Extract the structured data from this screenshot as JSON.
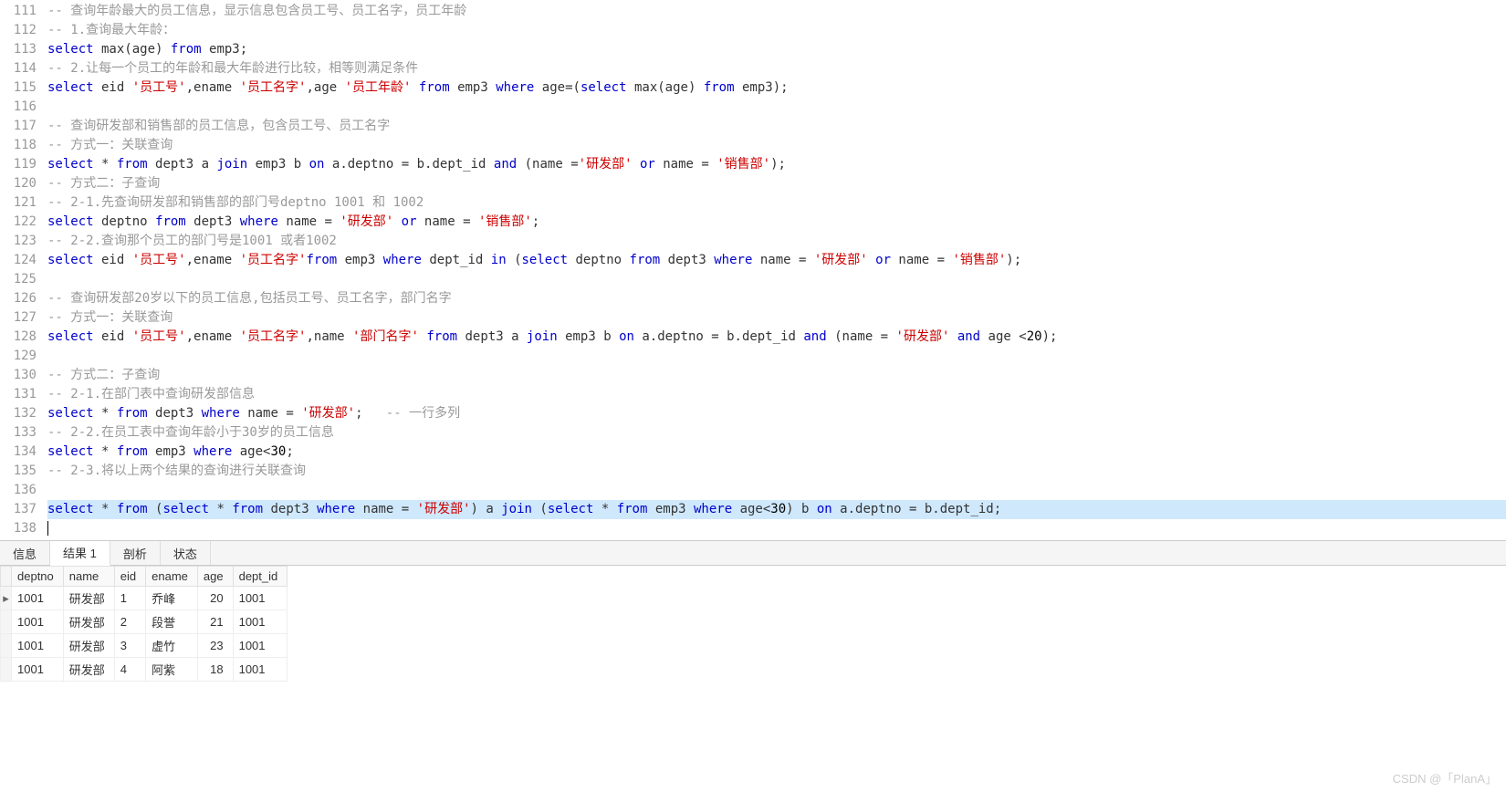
{
  "lines": [
    {
      "n": 111,
      "tokens": [
        {
          "t": "-- 查询年龄最大的员工信息，显示信息包含员工号、员工名字，员工年龄",
          "c": "cmt"
        }
      ]
    },
    {
      "n": 112,
      "tokens": [
        {
          "t": "-- 1.查询最大年龄：",
          "c": "cmt"
        }
      ]
    },
    {
      "n": 113,
      "tokens": [
        {
          "t": "select",
          "c": "kw"
        },
        {
          "t": " max(age) ",
          "c": "ident"
        },
        {
          "t": "from",
          "c": "kw"
        },
        {
          "t": " emp3;",
          "c": "ident"
        }
      ]
    },
    {
      "n": 114,
      "tokens": [
        {
          "t": "-- 2.让每一个员工的年龄和最大年龄进行比较，相等则满足条件",
          "c": "cmt"
        }
      ]
    },
    {
      "n": 115,
      "tokens": [
        {
          "t": "select",
          "c": "kw"
        },
        {
          "t": " eid ",
          "c": "ident"
        },
        {
          "t": "'员工号'",
          "c": "str"
        },
        {
          "t": ",ename ",
          "c": "ident"
        },
        {
          "t": "'员工名字'",
          "c": "str"
        },
        {
          "t": ",age ",
          "c": "ident"
        },
        {
          "t": "'员工年龄'",
          "c": "str"
        },
        {
          "t": " ",
          "c": "ident"
        },
        {
          "t": "from",
          "c": "kw"
        },
        {
          "t": " emp3 ",
          "c": "ident"
        },
        {
          "t": "where",
          "c": "kw"
        },
        {
          "t": " age=(",
          "c": "ident"
        },
        {
          "t": "select",
          "c": "kw"
        },
        {
          "t": " max(age) ",
          "c": "ident"
        },
        {
          "t": "from",
          "c": "kw"
        },
        {
          "t": " emp3);",
          "c": "ident"
        }
      ]
    },
    {
      "n": 116,
      "tokens": []
    },
    {
      "n": 117,
      "tokens": [
        {
          "t": "-- 查询研发部和销售部的员工信息，包含员工号、员工名字",
          "c": "cmt"
        }
      ]
    },
    {
      "n": 118,
      "tokens": [
        {
          "t": "-- 方式一：关联查询",
          "c": "cmt"
        }
      ]
    },
    {
      "n": 119,
      "tokens": [
        {
          "t": "select",
          "c": "kw"
        },
        {
          "t": " * ",
          "c": "ident"
        },
        {
          "t": "from",
          "c": "kw"
        },
        {
          "t": " dept3 a ",
          "c": "ident"
        },
        {
          "t": "join",
          "c": "kw"
        },
        {
          "t": " emp3 b ",
          "c": "ident"
        },
        {
          "t": "on",
          "c": "kw"
        },
        {
          "t": " a.deptno = b.dept_id ",
          "c": "ident"
        },
        {
          "t": "and",
          "c": "kw"
        },
        {
          "t": " (name =",
          "c": "ident"
        },
        {
          "t": "'研发部'",
          "c": "str"
        },
        {
          "t": " ",
          "c": "ident"
        },
        {
          "t": "or",
          "c": "kw"
        },
        {
          "t": " name = ",
          "c": "ident"
        },
        {
          "t": "'销售部'",
          "c": "str"
        },
        {
          "t": ");",
          "c": "ident"
        }
      ]
    },
    {
      "n": 120,
      "tokens": [
        {
          "t": "-- 方式二：子查询",
          "c": "cmt"
        }
      ]
    },
    {
      "n": 121,
      "tokens": [
        {
          "t": "-- 2-1.先查询研发部和销售部的部门号deptno 1001 和 1002",
          "c": "cmt"
        }
      ]
    },
    {
      "n": 122,
      "tokens": [
        {
          "t": "select",
          "c": "kw"
        },
        {
          "t": " deptno ",
          "c": "ident"
        },
        {
          "t": "from",
          "c": "kw"
        },
        {
          "t": " dept3 ",
          "c": "ident"
        },
        {
          "t": "where",
          "c": "kw"
        },
        {
          "t": " name = ",
          "c": "ident"
        },
        {
          "t": "'研发部'",
          "c": "str"
        },
        {
          "t": " ",
          "c": "ident"
        },
        {
          "t": "or",
          "c": "kw"
        },
        {
          "t": " name = ",
          "c": "ident"
        },
        {
          "t": "'销售部'",
          "c": "str"
        },
        {
          "t": ";",
          "c": "ident"
        }
      ]
    },
    {
      "n": 123,
      "tokens": [
        {
          "t": "-- 2-2.查询那个员工的部门号是1001 或者1002",
          "c": "cmt"
        }
      ]
    },
    {
      "n": 124,
      "tokens": [
        {
          "t": "select",
          "c": "kw"
        },
        {
          "t": " eid ",
          "c": "ident"
        },
        {
          "t": "'员工号'",
          "c": "str"
        },
        {
          "t": ",ename ",
          "c": "ident"
        },
        {
          "t": "'员工名字'",
          "c": "str"
        },
        {
          "t": "from",
          "c": "kw"
        },
        {
          "t": " emp3 ",
          "c": "ident"
        },
        {
          "t": "where",
          "c": "kw"
        },
        {
          "t": " dept_id ",
          "c": "ident"
        },
        {
          "t": "in",
          "c": "kw"
        },
        {
          "t": " (",
          "c": "ident"
        },
        {
          "t": "select",
          "c": "kw"
        },
        {
          "t": " deptno ",
          "c": "ident"
        },
        {
          "t": "from",
          "c": "kw"
        },
        {
          "t": " dept3 ",
          "c": "ident"
        },
        {
          "t": "where",
          "c": "kw"
        },
        {
          "t": " name = ",
          "c": "ident"
        },
        {
          "t": "'研发部'",
          "c": "str"
        },
        {
          "t": " ",
          "c": "ident"
        },
        {
          "t": "or",
          "c": "kw"
        },
        {
          "t": " name = ",
          "c": "ident"
        },
        {
          "t": "'销售部'",
          "c": "str"
        },
        {
          "t": ");",
          "c": "ident"
        }
      ]
    },
    {
      "n": 125,
      "tokens": []
    },
    {
      "n": 126,
      "tokens": [
        {
          "t": "-- 查询研发部20岁以下的员工信息,包括员工号、员工名字，部门名字",
          "c": "cmt"
        }
      ]
    },
    {
      "n": 127,
      "tokens": [
        {
          "t": "-- 方式一：关联查询",
          "c": "cmt"
        }
      ]
    },
    {
      "n": 128,
      "tokens": [
        {
          "t": "select",
          "c": "kw"
        },
        {
          "t": " eid ",
          "c": "ident"
        },
        {
          "t": "'员工号'",
          "c": "str"
        },
        {
          "t": ",ename ",
          "c": "ident"
        },
        {
          "t": "'员工名字'",
          "c": "str"
        },
        {
          "t": ",name ",
          "c": "ident"
        },
        {
          "t": "'部门名字'",
          "c": "str"
        },
        {
          "t": " ",
          "c": "ident"
        },
        {
          "t": "from",
          "c": "kw"
        },
        {
          "t": " dept3 a ",
          "c": "ident"
        },
        {
          "t": "join",
          "c": "kw"
        },
        {
          "t": " emp3 b ",
          "c": "ident"
        },
        {
          "t": "on",
          "c": "kw"
        },
        {
          "t": " a.deptno = b.dept_id ",
          "c": "ident"
        },
        {
          "t": "and",
          "c": "kw"
        },
        {
          "t": " (name = ",
          "c": "ident"
        },
        {
          "t": "'研发部'",
          "c": "str"
        },
        {
          "t": " ",
          "c": "ident"
        },
        {
          "t": "and",
          "c": "kw"
        },
        {
          "t": " age <",
          "c": "ident"
        },
        {
          "t": "20",
          "c": "num"
        },
        {
          "t": ");",
          "c": "ident"
        }
      ]
    },
    {
      "n": 129,
      "tokens": []
    },
    {
      "n": 130,
      "tokens": [
        {
          "t": "-- 方式二：子查询",
          "c": "cmt"
        }
      ]
    },
    {
      "n": 131,
      "tokens": [
        {
          "t": "-- 2-1.在部门表中查询研发部信息",
          "c": "cmt"
        }
      ]
    },
    {
      "n": 132,
      "tokens": [
        {
          "t": "select",
          "c": "kw"
        },
        {
          "t": " * ",
          "c": "ident"
        },
        {
          "t": "from",
          "c": "kw"
        },
        {
          "t": " dept3 ",
          "c": "ident"
        },
        {
          "t": "where",
          "c": "kw"
        },
        {
          "t": " name = ",
          "c": "ident"
        },
        {
          "t": "'研发部'",
          "c": "str"
        },
        {
          "t": ";   ",
          "c": "ident"
        },
        {
          "t": "-- 一行多列",
          "c": "cmt"
        }
      ]
    },
    {
      "n": 133,
      "tokens": [
        {
          "t": "-- 2-2.在员工表中查询年龄小于30岁的员工信息",
          "c": "cmt"
        }
      ]
    },
    {
      "n": 134,
      "tokens": [
        {
          "t": "select",
          "c": "kw"
        },
        {
          "t": " * ",
          "c": "ident"
        },
        {
          "t": "from",
          "c": "kw"
        },
        {
          "t": " emp3 ",
          "c": "ident"
        },
        {
          "t": "where",
          "c": "kw"
        },
        {
          "t": " age<",
          "c": "ident"
        },
        {
          "t": "30",
          "c": "num"
        },
        {
          "t": ";",
          "c": "ident"
        }
      ]
    },
    {
      "n": 135,
      "tokens": [
        {
          "t": "-- 2-3.将以上两个结果的查询进行关联查询",
          "c": "cmt"
        }
      ]
    },
    {
      "n": 136,
      "tokens": []
    },
    {
      "n": 137,
      "sel": true,
      "tokens": [
        {
          "t": "select",
          "c": "kw"
        },
        {
          "t": " * ",
          "c": "ident"
        },
        {
          "t": "from",
          "c": "kw"
        },
        {
          "t": " (",
          "c": "ident"
        },
        {
          "t": "select",
          "c": "kw"
        },
        {
          "t": " * ",
          "c": "ident"
        },
        {
          "t": "from",
          "c": "kw"
        },
        {
          "t": " dept3 ",
          "c": "ident"
        },
        {
          "t": "where",
          "c": "kw"
        },
        {
          "t": " name = ",
          "c": "ident"
        },
        {
          "t": "'研发部'",
          "c": "str"
        },
        {
          "t": ") a ",
          "c": "ident"
        },
        {
          "t": "join",
          "c": "kw"
        },
        {
          "t": " (",
          "c": "ident"
        },
        {
          "t": "select",
          "c": "kw"
        },
        {
          "t": " * ",
          "c": "ident"
        },
        {
          "t": "from",
          "c": "kw"
        },
        {
          "t": " emp3 ",
          "c": "ident"
        },
        {
          "t": "where",
          "c": "kw"
        },
        {
          "t": " age<",
          "c": "ident"
        },
        {
          "t": "30",
          "c": "num"
        },
        {
          "t": ") b ",
          "c": "ident"
        },
        {
          "t": "on",
          "c": "kw"
        },
        {
          "t": " a.deptno = b.dept_id;",
          "c": "ident"
        }
      ]
    },
    {
      "n": 138,
      "cursor": true,
      "tokens": []
    }
  ],
  "tabs": {
    "items": [
      "信息",
      "结果 1",
      "剖析",
      "状态"
    ],
    "active": 1
  },
  "result": {
    "columns": [
      "deptno",
      "name",
      "eid",
      "ename",
      "age",
      "dept_id"
    ],
    "rows": [
      {
        "marker": "▸",
        "cells": [
          "1001",
          "研发部",
          "1",
          "乔峰",
          "20",
          "1001"
        ]
      },
      {
        "marker": "",
        "cells": [
          "1001",
          "研发部",
          "2",
          "段誉",
          "21",
          "1001"
        ]
      },
      {
        "marker": "",
        "cells": [
          "1001",
          "研发部",
          "3",
          "虚竹",
          "23",
          "1001"
        ]
      },
      {
        "marker": "",
        "cells": [
          "1001",
          "研发部",
          "4",
          "阿紫",
          "18",
          "1001"
        ]
      }
    ],
    "numericCols": [
      4
    ]
  },
  "watermark": "CSDN @「PlanA」"
}
